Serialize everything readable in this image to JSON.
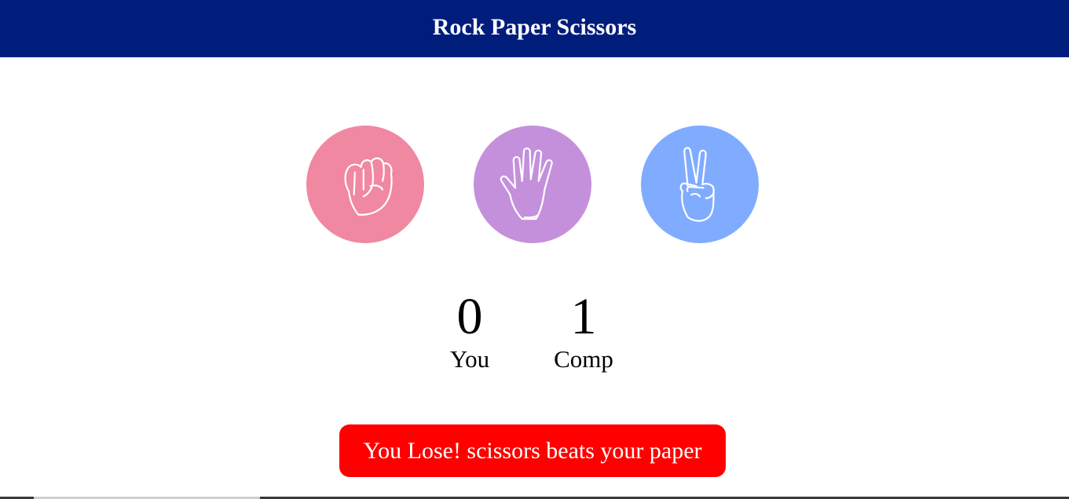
{
  "header": {
    "title": "Rock Paper Scissors"
  },
  "choices": [
    {
      "name": "rock",
      "icon": "fist-icon",
      "color": "#f088a2"
    },
    {
      "name": "paper",
      "icon": "open-hand-icon",
      "color": "#c490dc"
    },
    {
      "name": "scissors",
      "icon": "peace-sign-icon",
      "color": "#80acff"
    }
  ],
  "scoreboard": {
    "user": {
      "score": "0",
      "label": "You"
    },
    "comp": {
      "score": "1",
      "label": "Comp"
    }
  },
  "message": {
    "text": "You Lose! scissors beats your paper",
    "color": "#ff0000"
  },
  "colors": {
    "header_bg": "#001d7c",
    "text_on_dark": "#ffffff"
  }
}
